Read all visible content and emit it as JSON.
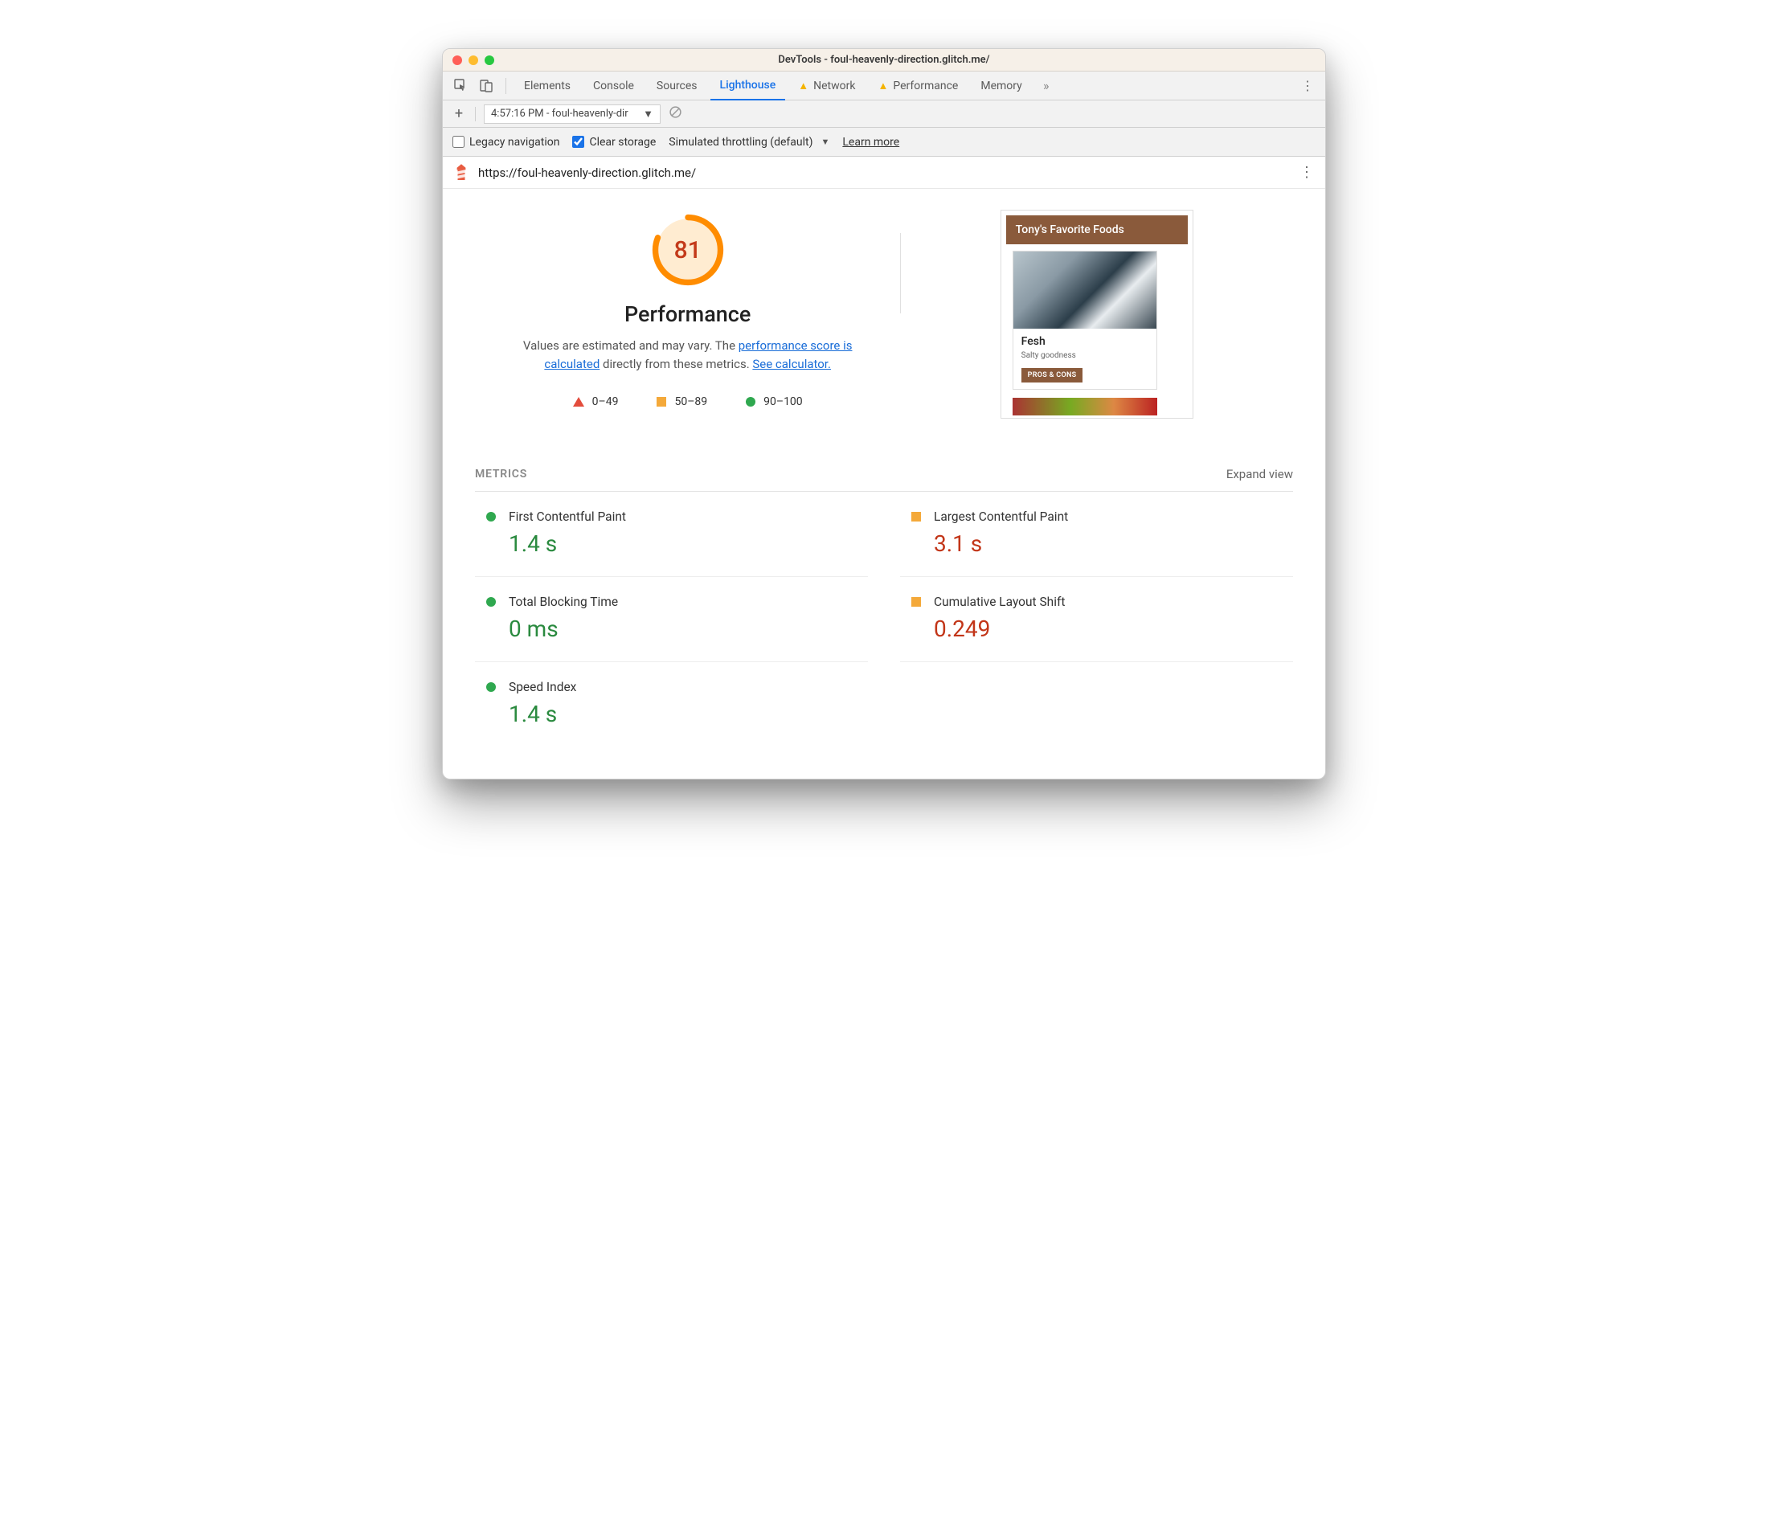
{
  "window_title": "DevTools - foul-heavenly-direction.glitch.me/",
  "tabs": {
    "elements": "Elements",
    "console": "Console",
    "sources": "Sources",
    "lighthouse": "Lighthouse",
    "network": "Network",
    "performance": "Performance",
    "memory": "Memory"
  },
  "report_dropdown": "4:57:16 PM - foul-heavenly-dir",
  "options": {
    "legacy": "Legacy navigation",
    "clear": "Clear storage",
    "throttling": "Simulated throttling (default)",
    "learn": "Learn more"
  },
  "url": "https://foul-heavenly-direction.glitch.me/",
  "gauge": {
    "score": "81",
    "category": "Performance"
  },
  "desc": {
    "p1": "Values are estimated and may vary. The ",
    "l1": "performance score is calculated",
    "p2": " directly from these metrics. ",
    "l2": "See calculator."
  },
  "legend": {
    "a": "0–49",
    "b": "50–89",
    "c": "90–100"
  },
  "preview": {
    "header": "Tony's Favorite Foods",
    "card_title": "Fesh",
    "card_sub": "Salty goodness",
    "btn": "PROS & CONS"
  },
  "metrics_title": "METRICS",
  "expand": "Expand view",
  "metrics": {
    "fcp": {
      "label": "First Contentful Paint",
      "value": "1.4 s"
    },
    "lcp": {
      "label": "Largest Contentful Paint",
      "value": "3.1 s"
    },
    "tbt": {
      "label": "Total Blocking Time",
      "value": "0 ms"
    },
    "cls": {
      "label": "Cumulative Layout Shift",
      "value": "0.249"
    },
    "si": {
      "label": "Speed Index",
      "value": "1.4 s"
    }
  }
}
